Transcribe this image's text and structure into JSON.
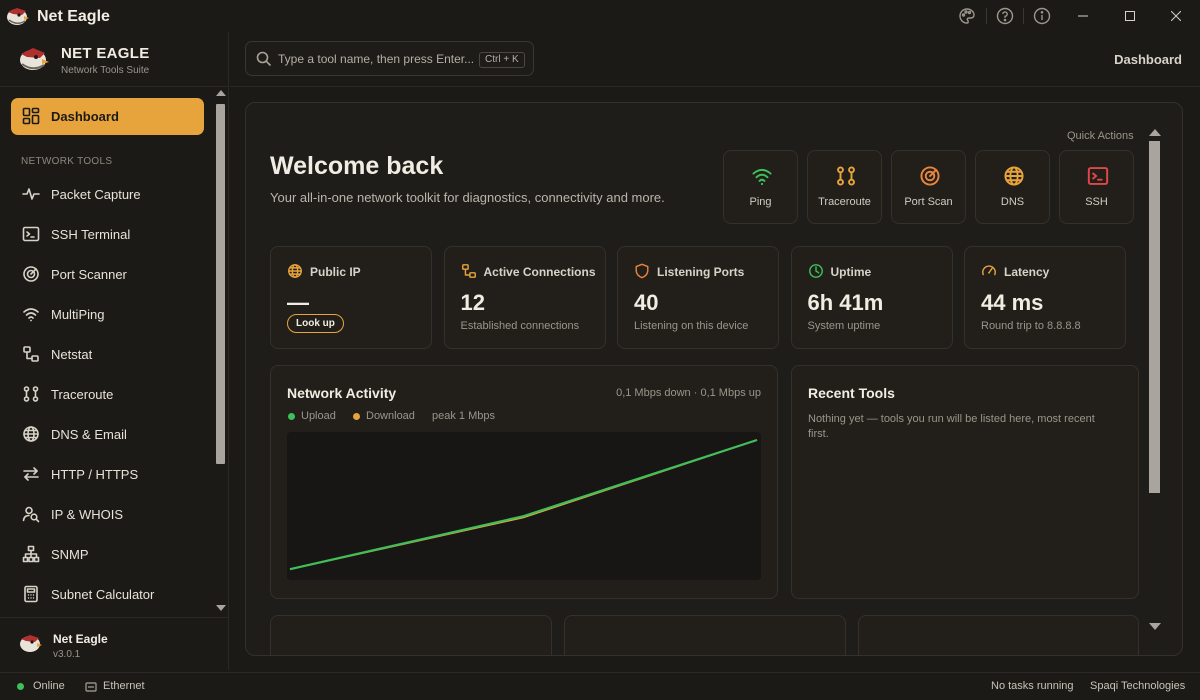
{
  "window": {
    "title": "Net Eagle"
  },
  "sidebar": {
    "brand_name": "NET EAGLE",
    "brand_subtitle": "Network Tools Suite",
    "active_item": "Dashboard",
    "section_label": "NETWORK TOOLS",
    "items": [
      {
        "label": "Packet Capture",
        "icon": "activity-icon"
      },
      {
        "label": "SSH Terminal",
        "icon": "terminal-icon"
      },
      {
        "label": "Port Scanner",
        "icon": "radar-icon"
      },
      {
        "label": "MultiPing",
        "icon": "wifi-icon"
      },
      {
        "label": "Netstat",
        "icon": "network-icon"
      },
      {
        "label": "Traceroute",
        "icon": "route-icon"
      },
      {
        "label": "DNS & Email",
        "icon": "globe-icon"
      },
      {
        "label": "HTTP / HTTPS",
        "icon": "arrows-icon"
      },
      {
        "label": "IP & WHOIS",
        "icon": "user-search-icon"
      },
      {
        "label": "SNMP",
        "icon": "sitemap-icon"
      },
      {
        "label": "Subnet Calculator",
        "icon": "calculator-icon"
      }
    ],
    "footer_name": "Net Eagle",
    "footer_version": "v3.0.1"
  },
  "header": {
    "search_placeholder": "Type a tool name, then press Enter...",
    "search_shortcut": "Ctrl + K",
    "breadcrumb": "Dashboard"
  },
  "welcome": {
    "title": "Welcome back",
    "subtitle": "Your all-in-one network toolkit for diagnostics, connectivity and more."
  },
  "quick_actions": {
    "label": "Quick Actions",
    "items": [
      {
        "label": "Ping",
        "icon": "wifi-icon",
        "color": "#3fbf5a"
      },
      {
        "label": "Traceroute",
        "icon": "route-icon",
        "color": "#e8a43c"
      },
      {
        "label": "Port Scan",
        "icon": "radar-icon",
        "color": "#e8843c"
      },
      {
        "label": "DNS",
        "icon": "globe-icon",
        "color": "#e8a43c"
      },
      {
        "label": "SSH",
        "icon": "terminal-icon",
        "color": "#e04848"
      }
    ]
  },
  "stats": [
    {
      "title": "Public IP",
      "value": "—",
      "subtitle": "",
      "action": "Look up",
      "icon": "globe-icon",
      "color": "#e8a43c"
    },
    {
      "title": "Active Connections",
      "value": "12",
      "subtitle": "Established connections",
      "icon": "network-icon",
      "color": "#e8a43c"
    },
    {
      "title": "Listening Ports",
      "value": "40",
      "subtitle": "Listening on this device",
      "icon": "shield-icon",
      "color": "#e8843c"
    },
    {
      "title": "Uptime",
      "value": "6h 41m",
      "subtitle": "System uptime",
      "icon": "clock-icon",
      "color": "#3fbf5a"
    },
    {
      "title": "Latency",
      "value": "44 ms",
      "subtitle": "Round trip to 8.8.8.8",
      "icon": "gauge-icon",
      "color": "#e8a43c"
    }
  ],
  "network_activity": {
    "title": "Network Activity",
    "rate": "0,1 Mbps down · 0,1 Mbps up",
    "legend_upload": "Upload",
    "legend_download": "Download",
    "peak": "peak 1 Mbps",
    "colors": {
      "upload": "#3fbf5a",
      "download": "#e8a43c"
    }
  },
  "chart_data": {
    "type": "line",
    "x": [
      0,
      1,
      2
    ],
    "series": [
      {
        "name": "Upload",
        "values": [
          0.05,
          0.44,
          1.0
        ]
      },
      {
        "name": "Download",
        "values": [
          0.05,
          0.43,
          1.0
        ]
      }
    ],
    "ylim": [
      0,
      1
    ]
  },
  "recent_tools": {
    "title": "Recent Tools",
    "empty_text": "Nothing yet — tools you run will be listed here, most recent first."
  },
  "statusbar": {
    "connection": "Online",
    "adapter": "Ethernet",
    "tasks": "No tasks running",
    "company": "Spaqi Technologies",
    "online_color": "#3fbf5a"
  }
}
